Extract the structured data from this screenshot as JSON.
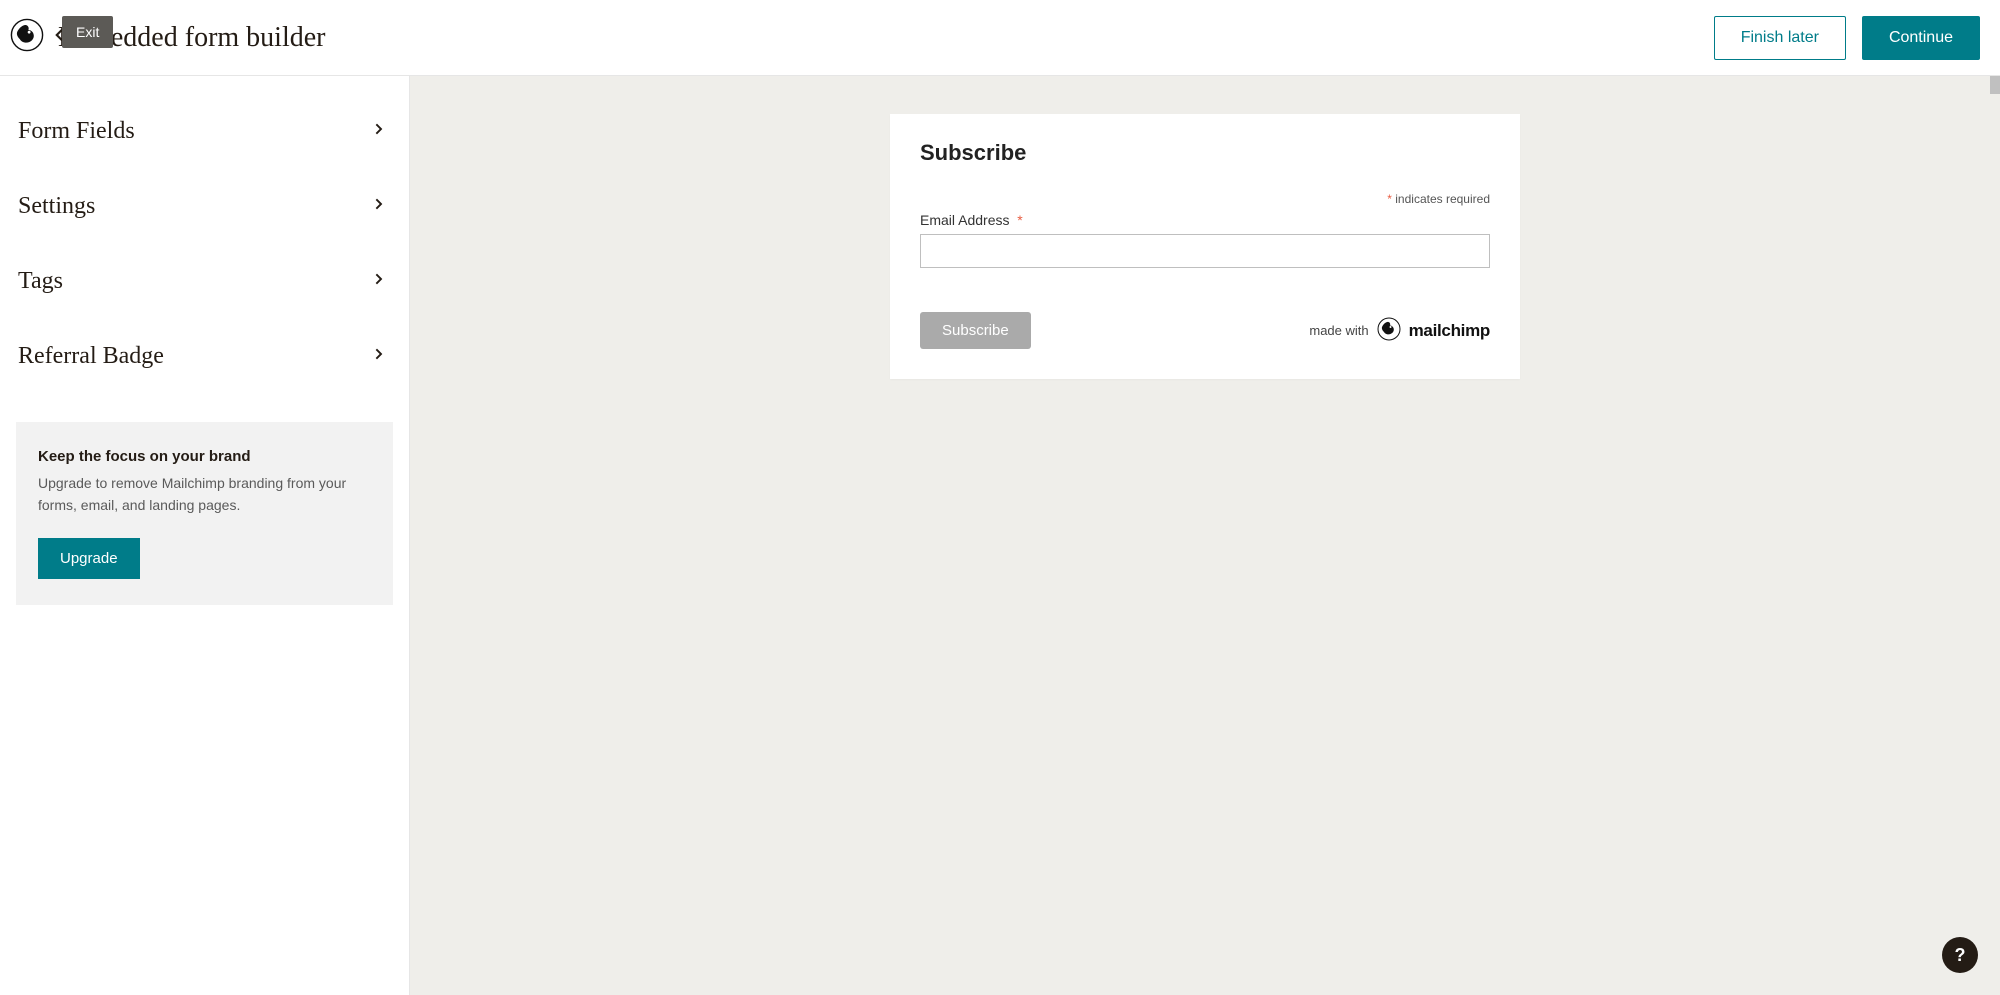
{
  "header": {
    "exit_label": "Exit",
    "title": "Embedded form builder",
    "finish_later_label": "Finish later",
    "continue_label": "Continue"
  },
  "sidebar": {
    "items": [
      {
        "label": "Form Fields"
      },
      {
        "label": "Settings"
      },
      {
        "label": "Tags"
      },
      {
        "label": "Referral Badge"
      }
    ],
    "promo": {
      "title": "Keep the focus on your brand",
      "body": "Upgrade to remove Mailchimp branding from your forms, email, and landing pages.",
      "cta": "Upgrade"
    }
  },
  "form": {
    "heading": "Subscribe",
    "required_note": "indicates required",
    "email_label": "Email Address",
    "email_value": "",
    "submit_label": "Subscribe",
    "made_with": "made with",
    "brand": "mailchimp"
  },
  "help": {
    "glyph": "?"
  }
}
